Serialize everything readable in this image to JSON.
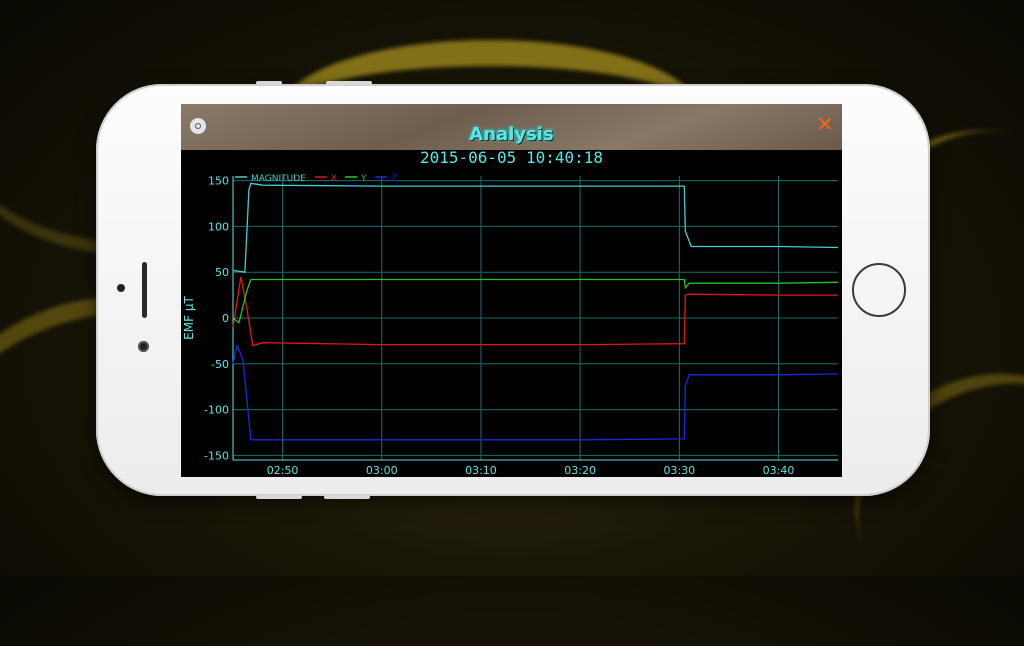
{
  "app": {
    "title": "Analysis",
    "timestamp": "2015-06-05 10:40:18"
  },
  "colors": {
    "accent": "#59e6e6",
    "grid": "#1f6e6e",
    "close": "#f06a1c"
  },
  "chart_data": {
    "type": "line",
    "ylabel": "EMF μT",
    "ylim": [
      -155,
      155
    ],
    "xlim": [
      "02:45",
      "03:46"
    ],
    "yticks": [
      150,
      100,
      50,
      0,
      -50,
      -100,
      -150
    ],
    "xticks": [
      "02:50",
      "03:00",
      "03:10",
      "03:20",
      "03:30",
      "03:40"
    ],
    "grid": true,
    "legend_position": "top-left",
    "series": [
      {
        "name": "MAGNITUDE",
        "color": "#3fd0d0",
        "points": [
          [
            "02:45",
            52
          ],
          [
            "02:46.2",
            50
          ],
          [
            "02:46.6",
            140
          ],
          [
            "02:46.8",
            147
          ],
          [
            "02:48",
            145
          ],
          [
            "03:00",
            144
          ],
          [
            "03:20",
            144
          ],
          [
            "03:30.5",
            144
          ],
          [
            "03:30.6",
            95
          ],
          [
            "03:31.2",
            78
          ],
          [
            "03:40",
            78
          ],
          [
            "03:46",
            77
          ]
        ]
      },
      {
        "name": "X",
        "color": "#e01818",
        "points": [
          [
            "02:45",
            -10
          ],
          [
            "02:45.8",
            45
          ],
          [
            "02:46.4",
            10
          ],
          [
            "02:47",
            -30
          ],
          [
            "02:48",
            -27
          ],
          [
            "03:00",
            -29
          ],
          [
            "03:20",
            -29
          ],
          [
            "03:30.5",
            -28
          ],
          [
            "03:30.6",
            25
          ],
          [
            "03:31",
            26
          ],
          [
            "03:40",
            25
          ],
          [
            "03:46",
            25
          ]
        ]
      },
      {
        "name": "Y",
        "color": "#20c820",
        "points": [
          [
            "02:45",
            0
          ],
          [
            "02:45.6",
            -5
          ],
          [
            "02:46.4",
            30
          ],
          [
            "02:46.8",
            42
          ],
          [
            "02:48",
            42
          ],
          [
            "03:00",
            42
          ],
          [
            "03:20",
            42
          ],
          [
            "03:30.5",
            42
          ],
          [
            "03:30.6",
            33
          ],
          [
            "03:31",
            38
          ],
          [
            "03:40",
            38
          ],
          [
            "03:46",
            39
          ]
        ]
      },
      {
        "name": "Z",
        "color": "#1a2ae0",
        "points": [
          [
            "02:45",
            -50
          ],
          [
            "02:45.4",
            -30
          ],
          [
            "02:46",
            -45
          ],
          [
            "02:46.8",
            -133
          ],
          [
            "02:48",
            -133
          ],
          [
            "03:00",
            -133
          ],
          [
            "03:20",
            -133
          ],
          [
            "03:30.5",
            -132
          ],
          [
            "03:30.6",
            -75
          ],
          [
            "03:31",
            -62
          ],
          [
            "03:40",
            -62
          ],
          [
            "03:46",
            -61
          ]
        ]
      }
    ]
  }
}
